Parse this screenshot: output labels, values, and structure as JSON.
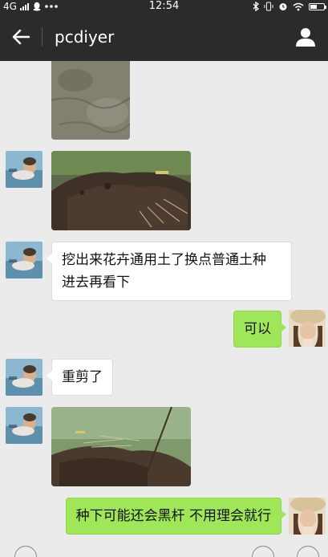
{
  "status_bar": {
    "network": "4G",
    "time": "12:54",
    "icons": [
      "signal-icon",
      "qq-icon",
      "more-dots-icon",
      "bluetooth-icon",
      "vibrate-icon",
      "alarm-icon",
      "wifi-icon",
      "battery-icon"
    ]
  },
  "header": {
    "back_icon": "back-arrow-icon",
    "title": "pcdiyer",
    "profile_icon": "person-icon"
  },
  "messages": [
    {
      "side": "left",
      "type": "image",
      "content": "photo of soil"
    },
    {
      "side": "left",
      "type": "image",
      "content": "photo of dug-up plant roots in soil"
    },
    {
      "side": "left",
      "type": "text",
      "lines": [
        "挖出来花卉通用土了换点普通土种",
        "进去再看下"
      ]
    },
    {
      "side": "right",
      "type": "text",
      "text": "可以"
    },
    {
      "side": "left",
      "type": "text",
      "text": "重剪了"
    },
    {
      "side": "left",
      "type": "image",
      "content": "photo of pruned plant in soil"
    },
    {
      "side": "right",
      "type": "text",
      "text": "种下可能还会黑杆 不用理会就行"
    }
  ],
  "colors": {
    "header_bg": "#2b2b2b",
    "chat_bg": "#ebebeb",
    "bubble_sent": "#9fe658",
    "bubble_received": "#ffffff"
  }
}
